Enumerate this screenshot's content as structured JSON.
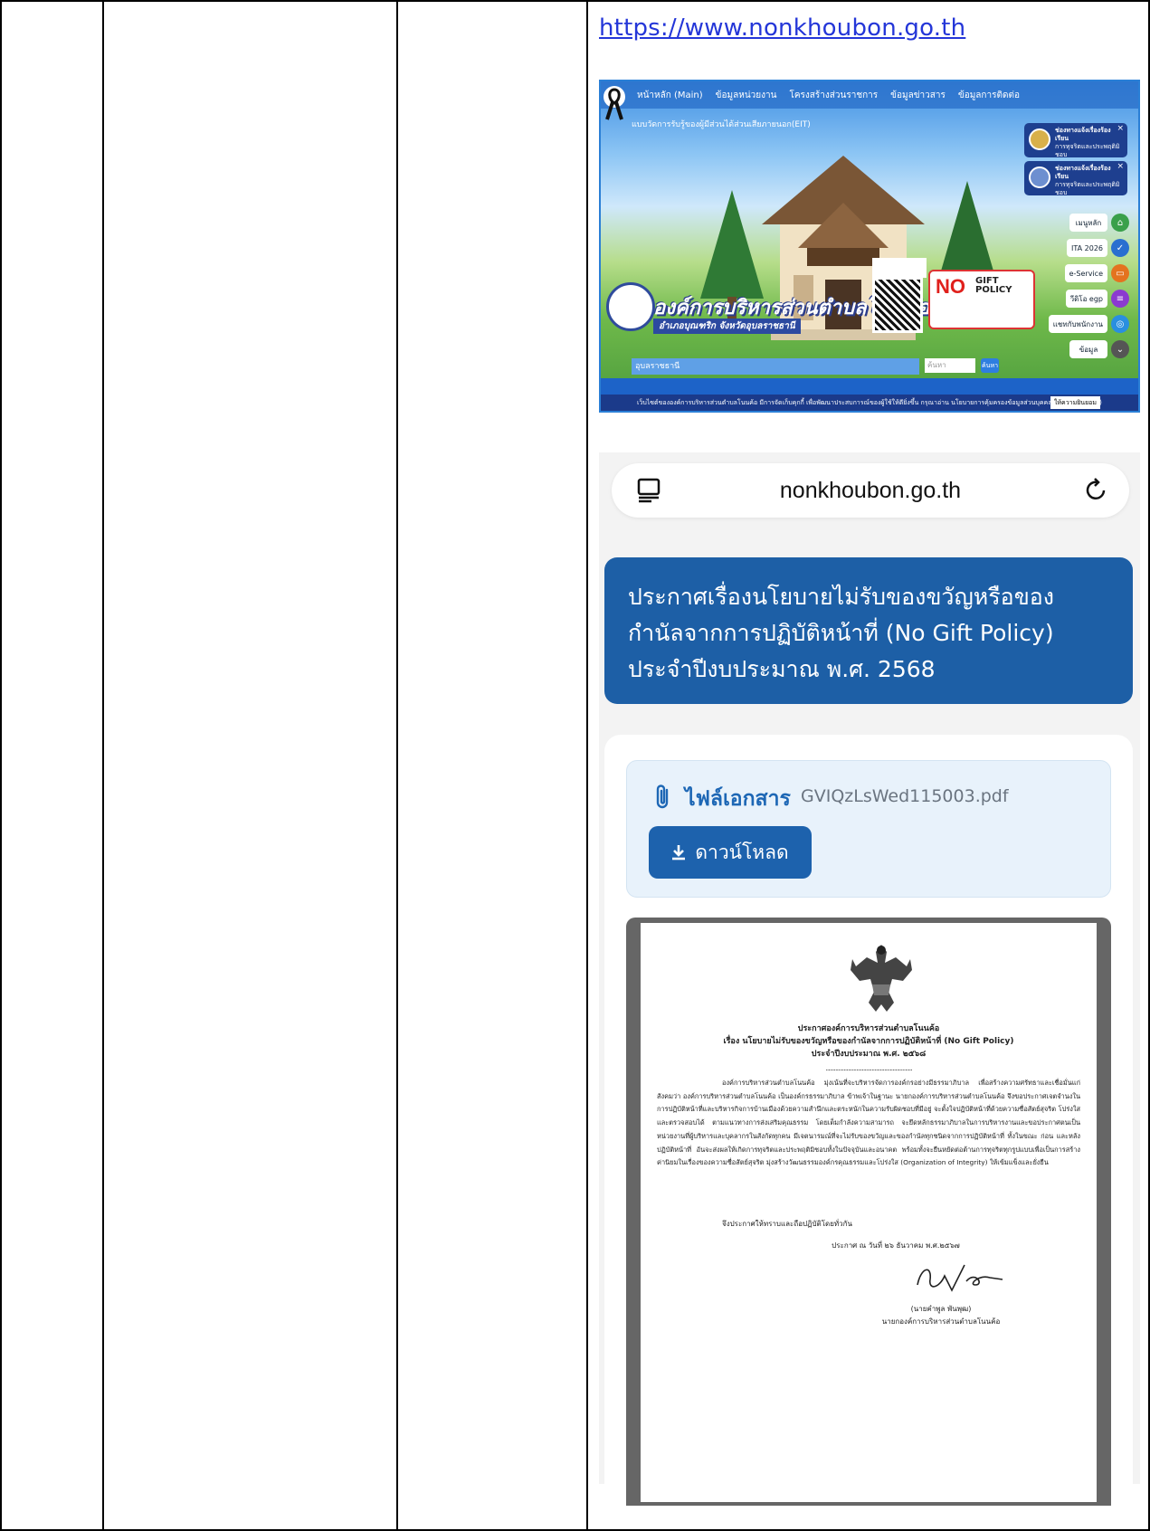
{
  "link_url": "https://www.nonkhoubon.go.th",
  "website": {
    "nav_items": [
      "หน้าหลัก (Main)",
      "ข้อมูลหน่วยงาน",
      "โครงสร้างส่วนราชการ",
      "ข้อมูลข่าวสาร",
      "ข้อมูลการติดต่อ"
    ],
    "ticker": "แบบวัดการรับรู้ของผู้มีส่วนได้ส่วนเสียภายนอก(EIT)",
    "notifications": [
      {
        "title": "ช่องทางแจ้งเรื่องร้องเรียน",
        "line2": "การทุจริตและประพฤติมิชอบ",
        "line3": "ช่องทางแจ้งเรื่องร้องเรียน ผ่าน..."
      },
      {
        "title": "ช่องทางแจ้งเรื่องร้องเรียน",
        "line2": "การทุจริตและประพฤติมิชอบ",
        "line3": "ช่องทางแจ้งเรื่องร้องเรียน ผ่าน..."
      }
    ],
    "side_buttons": [
      "เมนูหลัก",
      "ITA 2026",
      "e-Service",
      "วีดิโอ egp",
      "แชทกับพนักงาน",
      "ข้อมูล"
    ],
    "org_name": "องค์การบริหารส่วนตำบลโนนค้อ",
    "org_subtitle": "อำเภอบุณฑริก จังหวัดอุบลราชธานี",
    "no_gift_text": "NO",
    "gift_policy_text": "GIFT\nPOLICY",
    "search_label": "อุบลราชธานี",
    "search_placeholder": "ค้นหา",
    "search_button": "ค้นหา",
    "cookie_text": "เว็บไซต์ขององค์การบริหารส่วนตำบลโนนค้อ มีการจัดเก็บคุกกี้ เพื่อพัฒนาประสบการณ์ของผู้ใช้ให้ดียิ่งขึ้น กรุณาอ่าน นโยบายการคุ้มครองข้อมูลส่วนบุคคล (Privacy Policy)",
    "cookie_accept": "ให้ความยินยอม"
  },
  "mobile": {
    "domain": "nonkhoubon.go.th",
    "announcement_title": "ประกาศเรื่องนโยบายไม่รับของขวัญหรือของกำนัลจากการปฏิบัติหน้าที่ (No Gift Policy) ประจำปีงบประมาณ พ.ศ. 2568",
    "file_label": "ไฟล์เอกสาร",
    "file_name": "GVIQzLsWed115003.pdf",
    "download_label": "ดาวน์โหลด"
  },
  "document": {
    "title_line1": "ประกาศองค์การบริหารส่วนตำบลโนนค้อ",
    "title_line2": "เรื่อง นโยบายไม่รับของขวัญหรือของกำนัลจากการปฏิบัติหน้าที่ (No Gift Policy)",
    "title_line3": "ประจำปีงบประมาณ พ.ศ. ๒๕๖๘",
    "dots": "..............................................................",
    "body": "องค์การบริหารส่วนตำบลโนนค้อ มุ่งเน้นที่จะบริหารจัดการองค์กรอย่างมีธรรมาภิบาล เพื่อสร้างความศรัทธาและเชื่อมั่นแก่สังคมว่า องค์การบริหารส่วนตำบลโนนค้อ เป็นองค์กรธรรมาภิบาล ข้าพเจ้าในฐานะ นายกองค์การบริหารส่วนตำบลโนนค้อ จึงขอประกาศเจตจำนงในการปฏิบัติหน้าที่และบริหารกิจการบ้านเมืองด้วยความสำนึกและตระหนักในความรับผิดชอบที่มีอยู่ จะตั้งใจปฏิบัติหน้าที่ด้วยความซื่อสัตย์สุจริต โปร่งใส และตรวจสอบได้ ตามแนวทางการส่งเสริมคุณธรรม โดยเต็มกำลังความสามารถ จะยึดหลักธรรมาภิบาลในการบริหารงานและขอประกาศตนเป็นหน่วยงานที่ผู้บริหารและบุคลากรในสังกัดทุกคน มีเจตนารมณ์ที่จะไม่รับของขวัญและของกำนัลทุกชนิดจากการปฏิบัติหน้าที่ ทั้งในขณะ ก่อน และหลังปฏิบัติหน้าที่ อันจะส่งผลให้เกิดการทุจริตและประพฤติมิชอบทั้งในปัจจุบันและอนาคต พร้อมทั้งจะยืนหยัดต่อต้านการทุจริตทุกรูปแบบเพื่อเป็นการสร้างค่านิยมในเรื่องของความซื่อสัตย์สุจริต มุ่งสร้างวัฒนธรรมองค์กรคุณธรรมและโปร่งใส (Organization of Integrity) ให้เข้มแข็งและยั่งยืน",
    "closing": "จึงประกาศให้ทราบและถือปฏิบัติโดยทั่วกัน",
    "date": "ประกาศ ณ วันที่  ๒๖  ธันวาคม พ.ศ.๒๕๖๗",
    "signer_name": "(นายคำพูล พันพุฒ)",
    "signer_title": "นายกองค์การบริหารส่วนตำบลโนนค้อ"
  },
  "colors": {
    "link": "#2436d8",
    "title_card": "#1d5fa6",
    "download_button": "#1d62ad",
    "file_label": "#1d67b5"
  }
}
